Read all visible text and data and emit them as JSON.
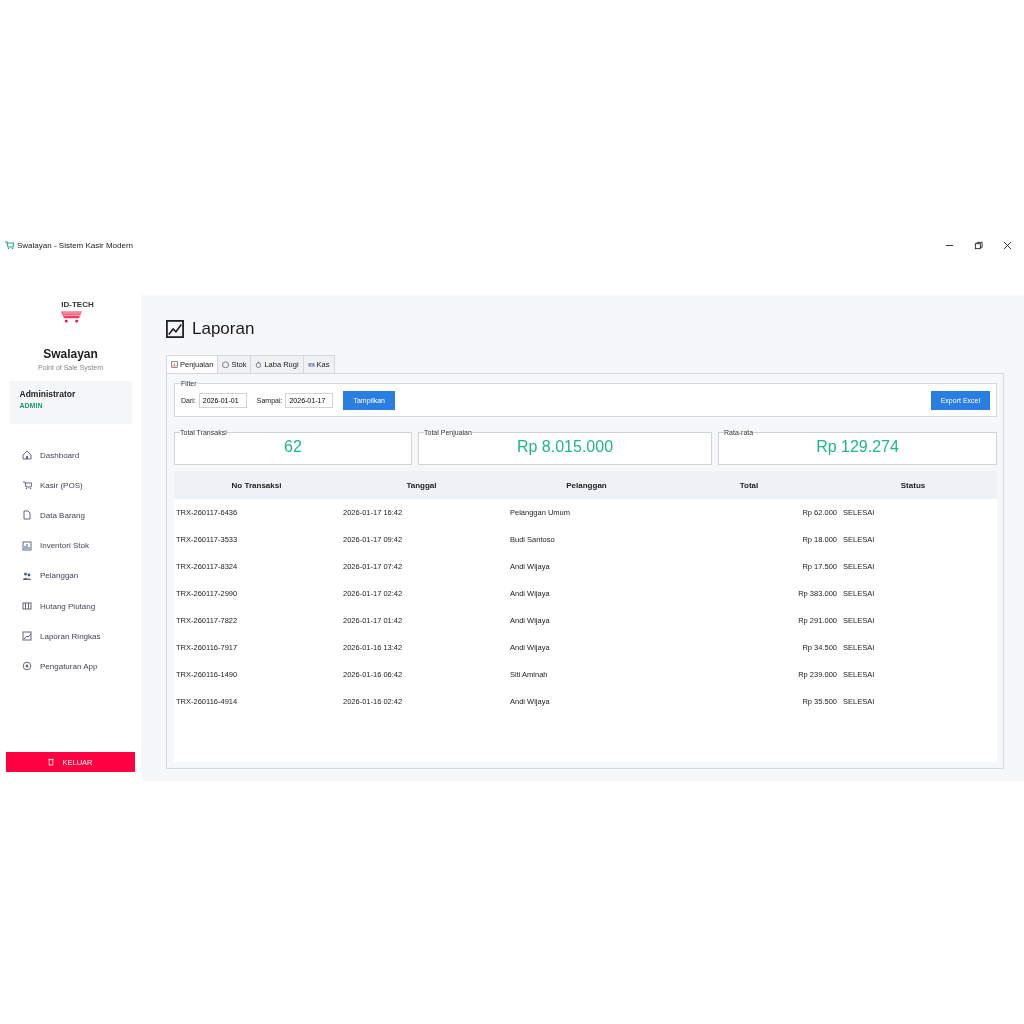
{
  "window": {
    "title": "Swalayan - Sistem Kasir Modern"
  },
  "sidebar": {
    "logo_text": "ID-TECH",
    "app_name": "Swalayan",
    "tagline": "Point of Sale System",
    "user": {
      "name": "Administrator",
      "role": "ADMIN"
    },
    "items": [
      {
        "label": "Dashboard",
        "kind": "home"
      },
      {
        "label": "Kasir (POS)",
        "kind": "cart"
      },
      {
        "label": "Data Barang",
        "kind": "doc"
      },
      {
        "label": "Inventori Stok",
        "kind": "chart"
      },
      {
        "label": "Pelanggan",
        "kind": "people"
      },
      {
        "label": "Hutang Piutang",
        "kind": "ledger"
      },
      {
        "label": "Laporan Ringkas",
        "kind": "report"
      },
      {
        "label": "Pengaturan App",
        "kind": "gear"
      }
    ],
    "logout": "KELUAR"
  },
  "page": {
    "title": "Laporan"
  },
  "tabs": [
    {
      "label": "Penjualan",
      "kind": "chart",
      "selected": true
    },
    {
      "label": "Stok",
      "kind": "box",
      "selected": false
    },
    {
      "label": "Laba Rugi",
      "kind": "money",
      "selected": false
    },
    {
      "label": "Kas",
      "kind": "cash",
      "selected": false
    }
  ],
  "filter": {
    "legend": "Filter",
    "from_label": "Dari:",
    "from": "2026-01-01",
    "to_label": "Sampai:",
    "to": "2026-01-17",
    "show_button": "Tampilkan",
    "export_button": "Export Excel"
  },
  "summary": [
    {
      "label": "Total Transaksi",
      "value": "62"
    },
    {
      "label": "Total Penjualan",
      "value": "Rp 8.015.000"
    },
    {
      "label": "Rata-rata",
      "value": "Rp 129.274"
    }
  ],
  "table": {
    "columns": [
      "No Transaksi",
      "Tanggal",
      "Pelanggan",
      "Total",
      "Status"
    ],
    "rows": [
      [
        "TRX-260117-6436",
        "2026-01-17 16:42",
        "Pelanggan Umum",
        "Rp 62.000",
        "SELESAI"
      ],
      [
        "TRX-260117-3533",
        "2026-01-17 09:42",
        "Budi Santoso",
        "Rp 18.000",
        "SELESAI"
      ],
      [
        "TRX-260117-8324",
        "2026-01-17 07:42",
        "Andi Wijaya",
        "Rp 17.500",
        "SELESAI"
      ],
      [
        "TRX-260117-2990",
        "2026-01-17 02:42",
        "Andi Wijaya",
        "Rp 383.000",
        "SELESAI"
      ],
      [
        "TRX-260117-7822",
        "2026-01-17 01:42",
        "Andi Wijaya",
        "Rp 291.000",
        "SELESAI"
      ],
      [
        "TRX-260116-7917",
        "2026-01-16 13:42",
        "Andi Wijaya",
        "Rp 34.500",
        "SELESAI"
      ],
      [
        "TRX-260116-1490",
        "2026-01-16 06:42",
        "Siti Aminah",
        "Rp 239.000",
        "SELESAI"
      ],
      [
        "TRX-260116-4914",
        "2026-01-16 02:42",
        "Andi Wijaya",
        "Rp 35.500",
        "SELESAI"
      ]
    ]
  }
}
